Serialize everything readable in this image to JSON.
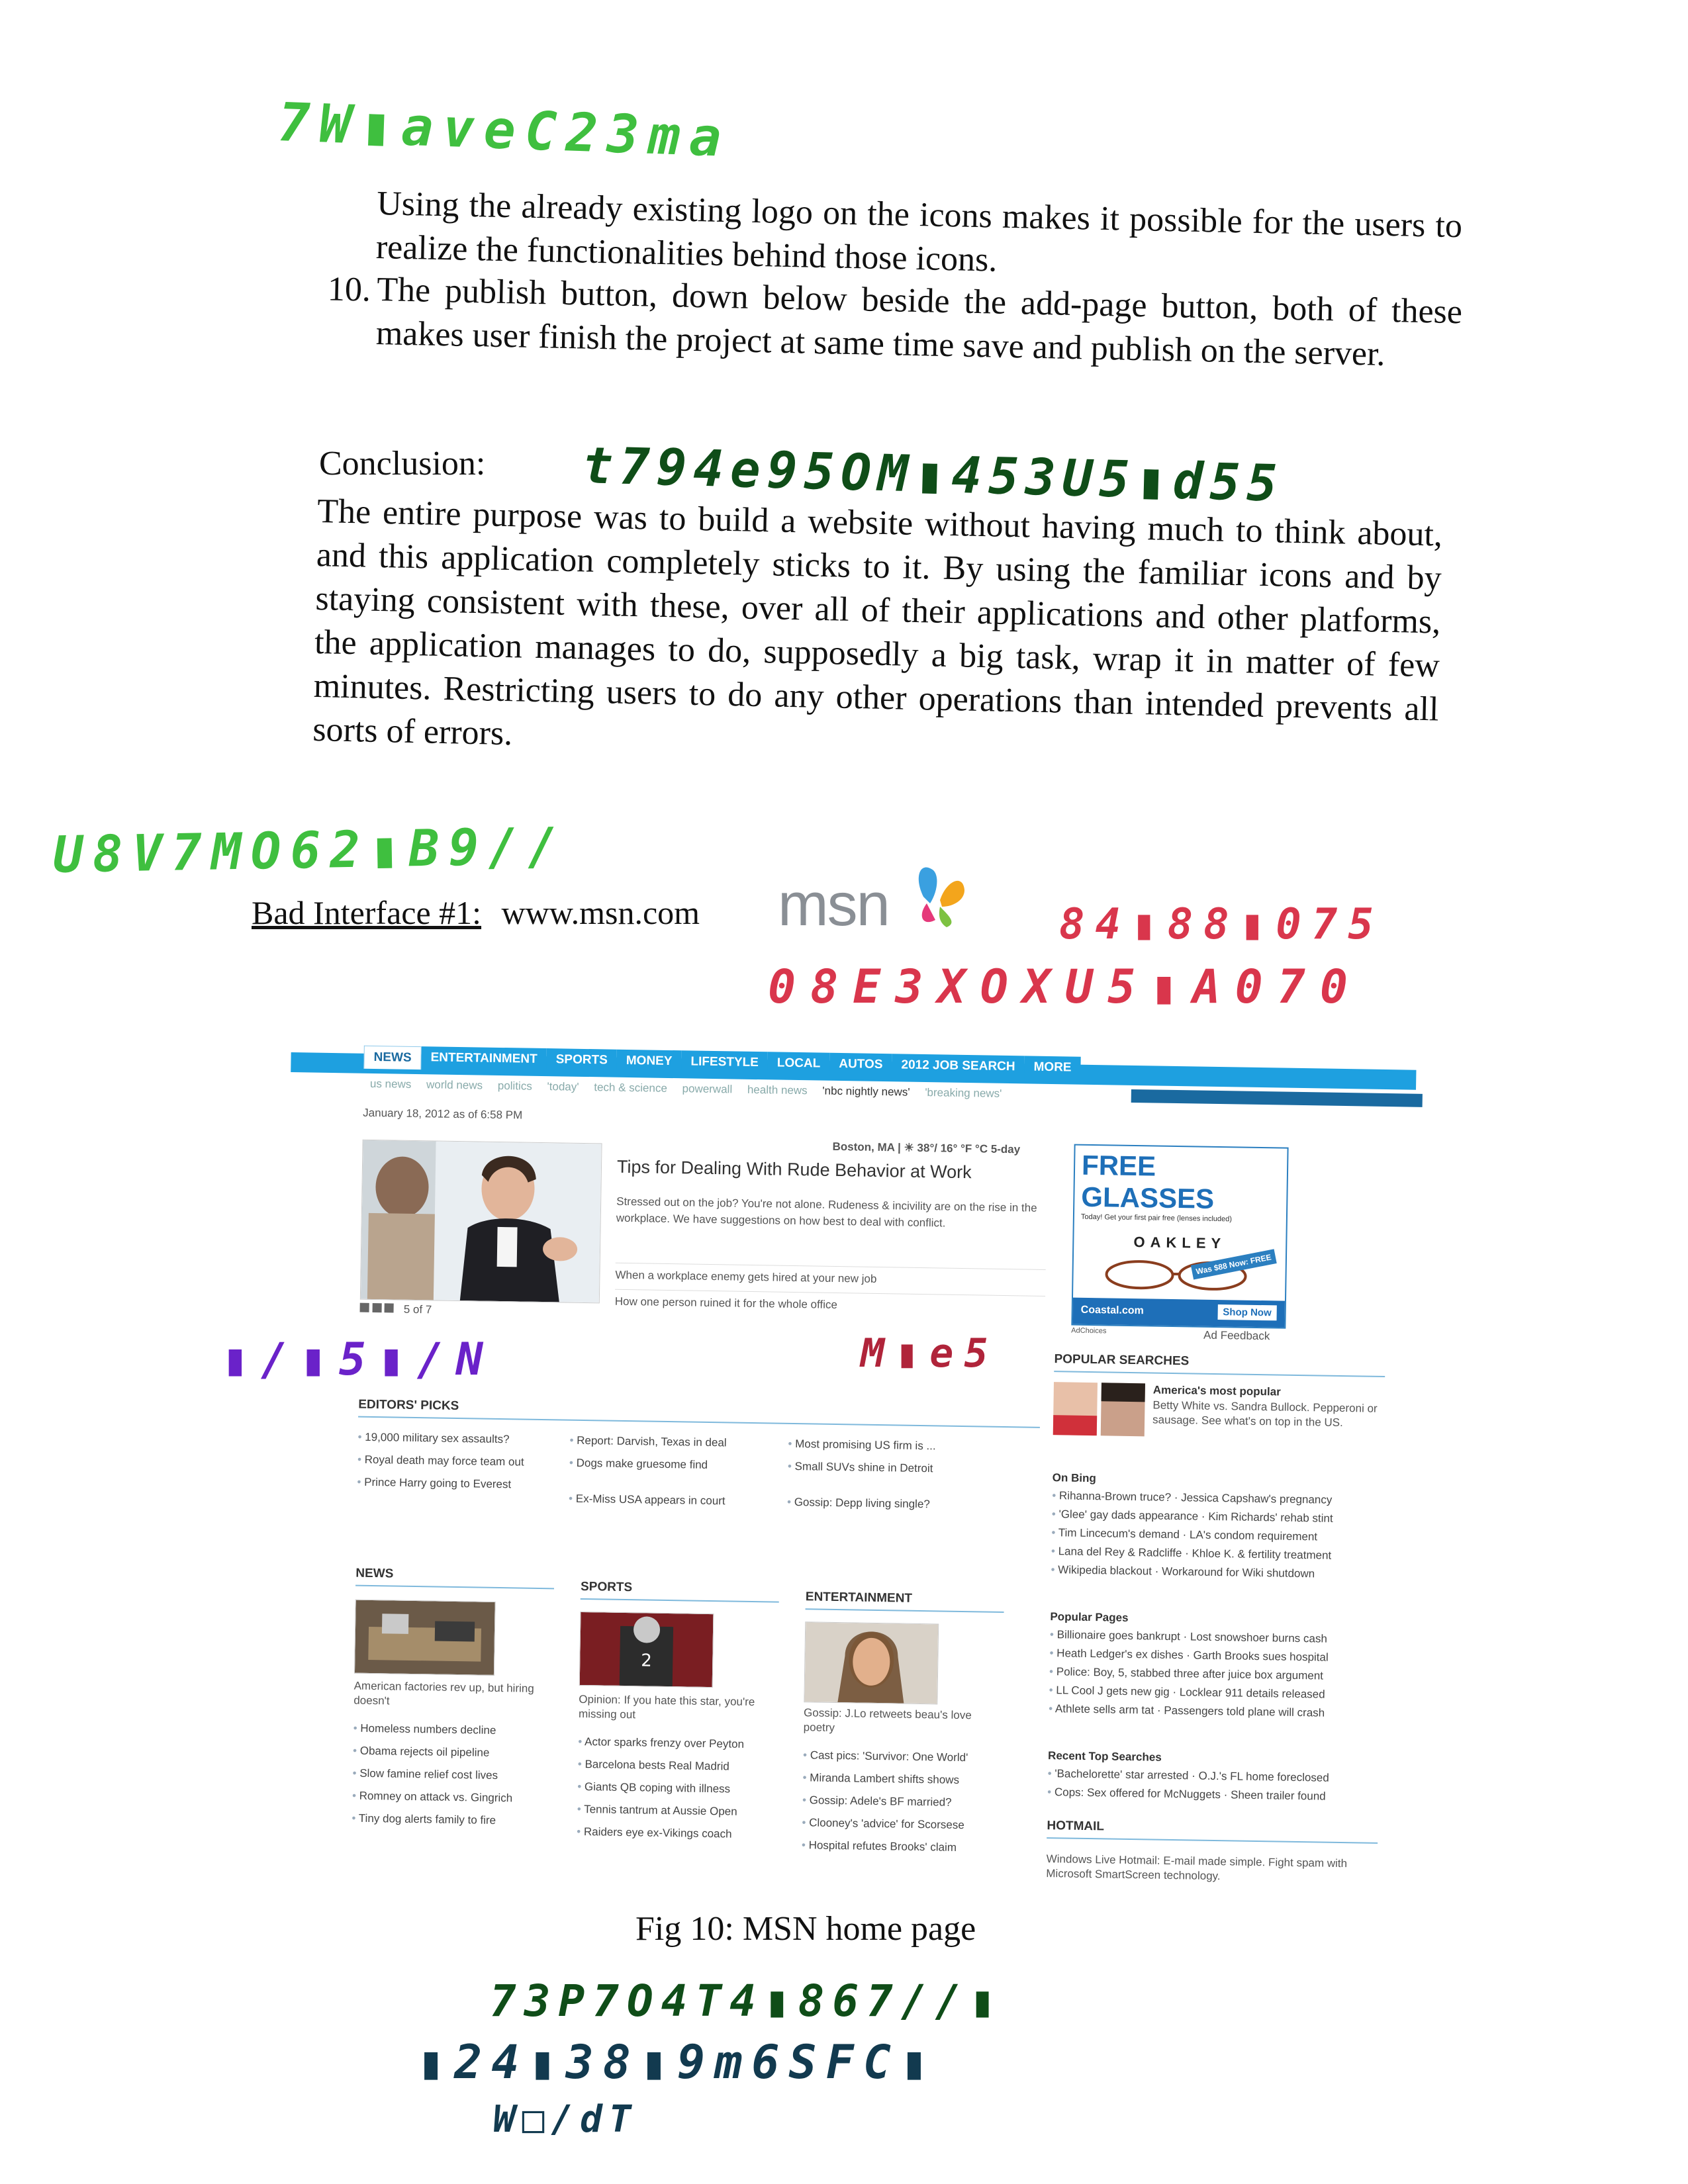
{
  "handwriting": {
    "line1": "7W▮aveC23ma",
    "line2": "t794e95OM▮453U5▮d55",
    "line3": "U8V7MO62▮B9//",
    "line4": "84▮88▮075",
    "line5": "08E3XOXU5▮A070",
    "line6": "▮/▮5▮/N",
    "line7": "M▮e5",
    "line8": "73P7O4T4▮867//▮",
    "line9": "▮24▮38▮9m6SFC▮",
    "line10": "W□/dT"
  },
  "document": {
    "para1": "Using the already existing logo on the icons makes it possible for the users to realize the functionalities behind those icons.",
    "item10_number": "10.",
    "item10_text": "The publish button, down below beside the add-page button, both of these makes user finish the project at same time save and publish on the server.",
    "conclusion_heading": "Conclusion:",
    "conclusion_text": "The entire purpose was to build a website without having much to think about, and this application completely sticks to it. By using the familiar icons and by staying consistent with these, over all of their applications and other platforms, the application manages to do, supposedly a big task, wrap it in matter of few minutes. Restricting users to do any other operations than intended prevents all sorts of errors.",
    "bad_interface_label": "Bad Interface #1:",
    "bad_interface_url": "www.msn.com",
    "msn_logo_text": "msn",
    "figure_caption": "Fig 10: MSN home page"
  },
  "msn_page": {
    "nav": [
      "NEWS",
      "ENTERTAINMENT",
      "SPORTS",
      "MONEY",
      "LIFESTYLE",
      "LOCAL",
      "AUTOS",
      "2012 JOB SEARCH",
      "MORE"
    ],
    "subnav": [
      "us news",
      "world news",
      "politics",
      "'today'",
      "tech & science",
      "powerwall",
      "health news",
      "'nbc nightly news'",
      "'breaking news'"
    ],
    "date": "January 18, 2012 as of 6:58 PM",
    "weather": "Boston, MA | ☀ 38°/ 16° °F °C 5-day",
    "hero_title": "Tips for Dealing With Rude Behavior at Work",
    "hero_blurb": "Stressed out on the job? You're not alone. Rudeness & incivility are on the rise in the workplace. We have suggestions on how best to deal with conflict.",
    "hero_link1": "When a workplace enemy gets hired at your new job",
    "hero_link2": "How one person ruined it for the whole office",
    "hero_counter": "5 of 7",
    "ad": {
      "headline": "FREE GLASSES",
      "sub": "Today! Get your first pair free (lenses included)",
      "brand": "OAKLEY",
      "badge": "Was $88 Now: FREE",
      "store": "Coastal.com",
      "cta": "Shop Now",
      "choices": "AdChoices",
      "feedback": "Ad Feedback"
    },
    "editors_picks": {
      "title": "EDITORS' PICKS",
      "col1": [
        "19,000 military sex assaults?",
        "Royal death may force team out",
        "Prince Harry going to Everest"
      ],
      "col2": [
        "Report: Darvish, Texas in deal",
        "Dogs make gruesome find",
        "Ex-Miss USA appears in court"
      ],
      "col3": [
        "Most promising US firm is ...",
        "Small SUVs shine in Detroit",
        "Gossip: Depp living single?"
      ]
    },
    "popular_searches": {
      "title": "POPULAR SEARCHES",
      "feature_title": "America's most popular",
      "feature_text": "Betty White vs. Sandra Bullock. Pepperoni or sausage. See what's on top in the US.",
      "on_bing_title": "On Bing",
      "on_bing": [
        "Rihanna-Brown truce? · Jessica Capshaw's pregnancy",
        "'Glee' gay dads appearance · Kim Richards' rehab stint",
        "Tim Lincecum's demand · LA's condom requirement",
        "Lana del Rey & Radcliffe · Khloe K. & fertility treatment",
        "Wikipedia blackout · Workaround for Wiki shutdown"
      ],
      "popular_pages_title": "Popular Pages",
      "popular_pages": [
        "Billionaire goes bankrupt · Lost snowshoer burns cash",
        "Heath Ledger's ex dishes · Garth Brooks sues hospital",
        "Police: Boy, 5, stabbed three after juice box argument",
        "LL Cool J gets new gig · Locklear 911 details released",
        "Athlete sells arm tat · Passengers told plane will crash"
      ],
      "recent_title": "Recent Top Searches",
      "recent": [
        "'Bachelorette' star arrested · O.J.'s FL home foreclosed",
        "Cops: Sex offered for McNuggets · Sheen trailer found"
      ]
    },
    "hotmail": {
      "title": "HOTMAIL",
      "text": "Windows Live Hotmail: E-mail made simple. Fight spam with Microsoft SmartScreen technology."
    },
    "news": {
      "title": "NEWS",
      "caption": "American factories rev up, but hiring doesn't",
      "items": [
        "Homeless numbers decline",
        "Obama rejects oil pipeline",
        "Slow famine relief cost lives",
        "Romney on attack vs. Gingrich",
        "Tiny dog alerts family to fire"
      ]
    },
    "sports": {
      "title": "SPORTS",
      "caption": "Opinion: If you hate this star, you're missing out",
      "items": [
        "Actor sparks frenzy over Peyton",
        "Barcelona bests Real Madrid",
        "Giants QB coping with illness",
        "Tennis tantrum at Aussie Open",
        "Raiders eye ex-Vikings coach"
      ]
    },
    "entertainment": {
      "title": "ENTERTAINMENT",
      "caption": "Gossip: J.Lo retweets beau's love poetry",
      "items": [
        "Cast pics: 'Survivor: One World'",
        "Miranda Lambert shifts shows",
        "Gossip: Adele's BF married?",
        "Clooney's 'advice' for Scorsese",
        "Hospital refutes Brooks' claim"
      ]
    }
  }
}
